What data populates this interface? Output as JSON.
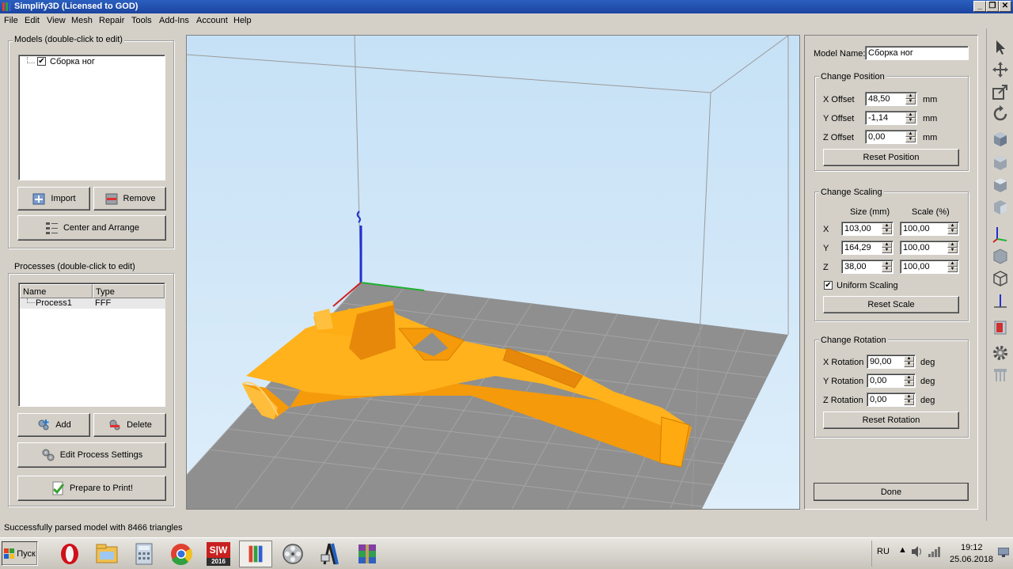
{
  "window": {
    "title": "Simplify3D (Licensed to GOD)",
    "controls": [
      "_",
      "❐",
      "✕"
    ]
  },
  "menu": [
    "File",
    "Edit",
    "View",
    "Mesh",
    "Repair",
    "Tools",
    "Add-Ins",
    "Account",
    "Help"
  ],
  "models_panel": {
    "title": "Models (double-click to edit)",
    "items": [
      {
        "name": "Сборка ног",
        "checked": true
      }
    ],
    "import_label": "Import",
    "remove_label": "Remove",
    "center_arrange_label": "Center and Arrange"
  },
  "processes_panel": {
    "title": "Processes (double-click to edit)",
    "columns": [
      "Name",
      "Type"
    ],
    "rows": [
      {
        "name": "Process1",
        "type": "FFF"
      }
    ],
    "add_label": "Add",
    "delete_label": "Delete",
    "edit_settings_label": "Edit Process Settings",
    "prepare_label": "Prepare to Print!"
  },
  "model_editor": {
    "model_name_label": "Model Name:",
    "model_name_value": "Сборка ног",
    "position": {
      "title": "Change Position",
      "x_label": "X Offset",
      "x_value": "48,50",
      "y_label": "Y Offset",
      "y_value": "-1,14",
      "z_label": "Z Offset",
      "z_value": "0,00",
      "unit": "mm",
      "reset_label": "Reset Position"
    },
    "scaling": {
      "title": "Change Scaling",
      "size_header": "Size (mm)",
      "scale_header": "Scale (%)",
      "rows": [
        {
          "axis": "X",
          "size": "103,00",
          "scale": "100,00"
        },
        {
          "axis": "Y",
          "size": "164,29",
          "scale": "100,00"
        },
        {
          "axis": "Z",
          "size": "38,00",
          "scale": "100,00"
        }
      ],
      "uniform_label": "Uniform Scaling",
      "uniform_checked": true,
      "reset_label": "Reset Scale"
    },
    "rotation": {
      "title": "Change Rotation",
      "x_label": "X Rotation",
      "x_value": "90,00",
      "y_label": "Y Rotation",
      "y_value": "0,00",
      "z_label": "Z Rotation",
      "z_value": "0,00",
      "unit": "deg",
      "reset_label": "Reset Rotation"
    },
    "done_label": "Done"
  },
  "status": {
    "message": "Successfully parsed model with 8466 triangles"
  },
  "taskbar": {
    "start_label": "Пуск",
    "lang": "RU",
    "time": "19:12",
    "date": "25.06.2018",
    "solidworks_badge": "2016"
  },
  "colors": {
    "viewport_bg": "#cfe6f7",
    "bed": "#8e8e8e",
    "model": "#ffa500",
    "titlebar": "#1f4ea8"
  }
}
